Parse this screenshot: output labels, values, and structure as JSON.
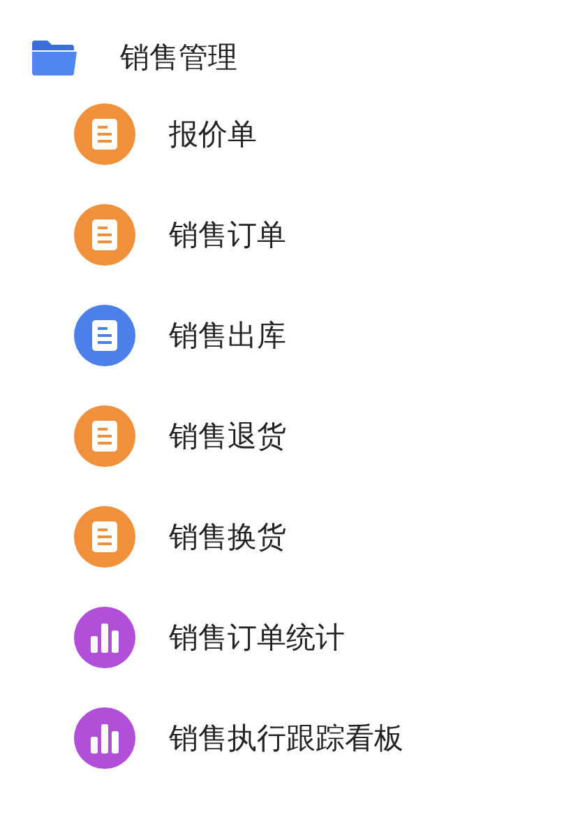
{
  "tree": {
    "label": "销售管理",
    "children": [
      {
        "label": "报价单",
        "kind": "document",
        "color": "#f0903a"
      },
      {
        "label": "销售订单",
        "kind": "document",
        "color": "#f0903a"
      },
      {
        "label": "销售出库",
        "kind": "document",
        "color": "#4a80e8"
      },
      {
        "label": "销售退货",
        "kind": "document",
        "color": "#f0903a"
      },
      {
        "label": "销售换货",
        "kind": "document",
        "color": "#f0903a"
      },
      {
        "label": "销售订单统计",
        "kind": "chart",
        "color": "#b24fd8"
      },
      {
        "label": "销售执行跟踪看板",
        "kind": "chart",
        "color": "#b24fd8"
      }
    ]
  }
}
